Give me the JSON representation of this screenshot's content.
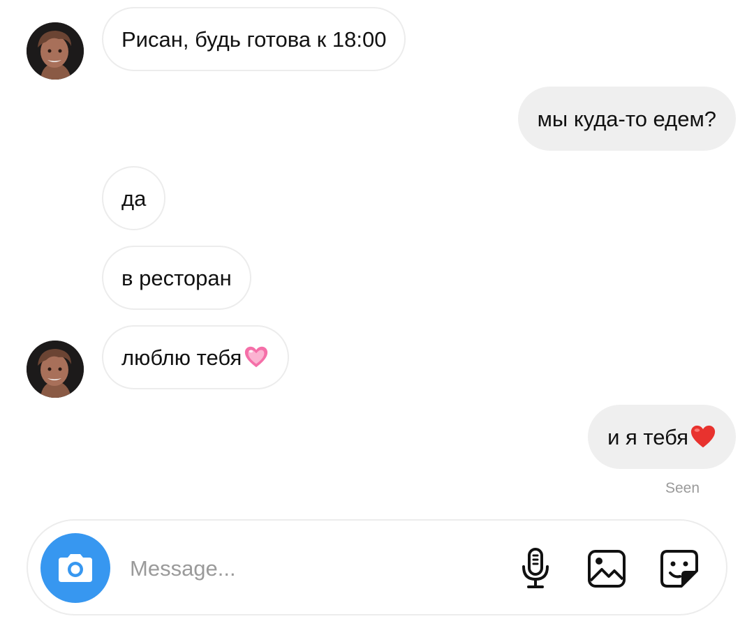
{
  "conversation": {
    "messages": [
      {
        "sender": "them",
        "text": "Рисан, будь готова к 18:00"
      },
      {
        "sender": "me",
        "text": "мы куда-то едем?"
      },
      {
        "sender": "them",
        "text": "да"
      },
      {
        "sender": "them",
        "text": "в ресторан"
      },
      {
        "sender": "them",
        "text": "люблю тебя",
        "emoji": "pink-heart"
      },
      {
        "sender": "me",
        "text": "и я тебя ",
        "emoji": "red-heart"
      }
    ],
    "read_receipt": "Seen"
  },
  "composer": {
    "placeholder": "Message...",
    "icons": {
      "camera": "camera-icon",
      "microphone": "microphone-icon",
      "gallery": "gallery-icon",
      "sticker": "sticker-icon"
    }
  },
  "colors": {
    "camera_button": "#3797f0",
    "outgoing_bubble": "#efefef",
    "incoming_border": "#ececec",
    "seen_text": "#9a9a9a"
  }
}
